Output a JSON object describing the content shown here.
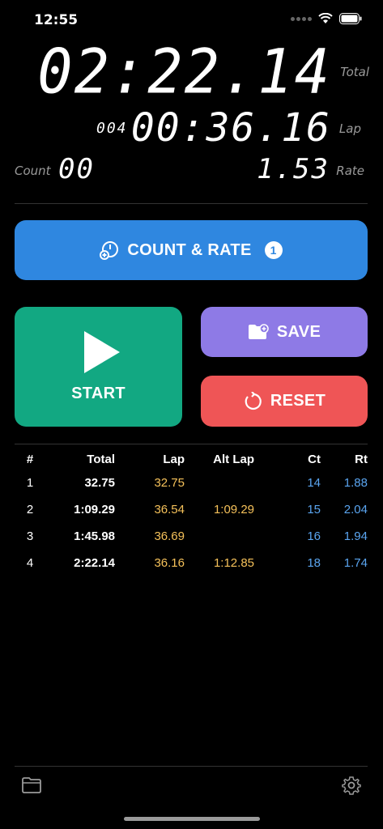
{
  "status_bar": {
    "time": "12:55"
  },
  "timer": {
    "total": "02:22.14",
    "total_label": "Total",
    "lap_number": "004",
    "lap": "00:36.16",
    "lap_label": "Lap",
    "count_label": "Count",
    "count": "00",
    "rate": "1.53",
    "rate_label": "Rate"
  },
  "buttons": {
    "count_rate": "COUNT & RATE",
    "count_rate_badge": "1",
    "start": "START",
    "save": "SAVE",
    "reset": "RESET"
  },
  "table": {
    "headers": {
      "num": "#",
      "total": "Total",
      "lap": "Lap",
      "alt": "Alt Lap",
      "ct": "Ct",
      "rt": "Rt"
    },
    "rows": [
      {
        "num": "1",
        "total": "32.75",
        "lap": "32.75",
        "alt": "",
        "ct": "14",
        "rt": "1.88"
      },
      {
        "num": "2",
        "total": "1:09.29",
        "lap": "36.54",
        "alt": "1:09.29",
        "ct": "15",
        "rt": "2.04"
      },
      {
        "num": "3",
        "total": "1:45.98",
        "lap": "36.69",
        "alt": "",
        "ct": "16",
        "rt": "1.94"
      },
      {
        "num": "4",
        "total": "2:22.14",
        "lap": "36.16",
        "alt": "1:12.85",
        "ct": "18",
        "rt": "1.74"
      }
    ]
  },
  "colors": {
    "count_rate": "#2f87e0",
    "start": "#12a882",
    "save": "#8e7ae6",
    "reset": "#ef5556",
    "lap": "#f5c15a",
    "count": "#5aa5f0"
  },
  "icons": {
    "folder": "folder-icon",
    "settings": "gear-icon"
  }
}
